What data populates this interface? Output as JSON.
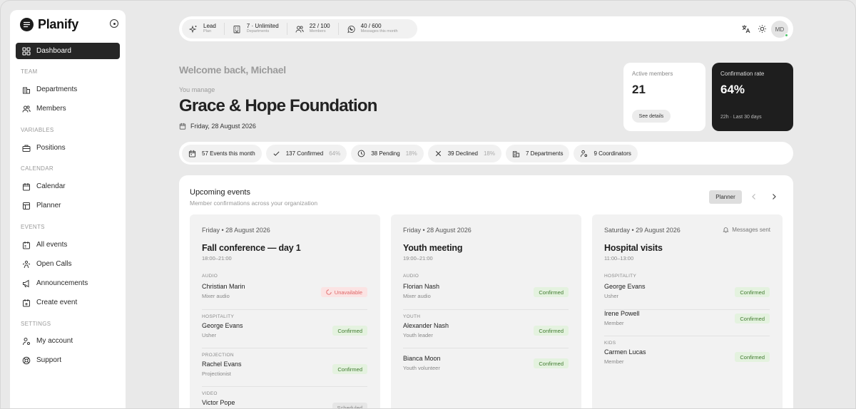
{
  "brand": {
    "name": "Planify"
  },
  "sidebar": {
    "items": [
      {
        "label": "Dashboard",
        "icon": "dashboard-icon",
        "active": true
      },
      {
        "section": "TEAM"
      },
      {
        "label": "Departments",
        "icon": "building-icon"
      },
      {
        "label": "Members",
        "icon": "users-icon"
      },
      {
        "section": "VARIABLES"
      },
      {
        "label": "Positions",
        "icon": "briefcase-icon"
      },
      {
        "section": "CALENDAR"
      },
      {
        "label": "Calendar",
        "icon": "calendar-icon"
      },
      {
        "label": "Planner",
        "icon": "grid-icon"
      },
      {
        "section": "EVENTS"
      },
      {
        "label": "All events",
        "icon": "calendar-list-icon"
      },
      {
        "label": "Open Calls",
        "icon": "people-call-icon"
      },
      {
        "label": "Announcements",
        "icon": "megaphone-icon"
      },
      {
        "label": "Create event",
        "icon": "calendar-plus-icon"
      },
      {
        "section": "SETTINGS"
      },
      {
        "label": "My account",
        "icon": "user-settings-icon"
      },
      {
        "label": "Support",
        "icon": "lifebuoy-icon"
      }
    ]
  },
  "topbar": {
    "stats": [
      {
        "main": "Lead",
        "sub": "Plan",
        "icon": "sparkle-icon"
      },
      {
        "main": "7 · Unlimited",
        "sub": "Departments",
        "icon": "building-icon"
      },
      {
        "main": "22 / 100",
        "sub": "Members",
        "icon": "users-icon"
      },
      {
        "main": "40 / 600",
        "sub": "Messages this month",
        "icon": "whatsapp-icon"
      }
    ],
    "avatar_initials": "MD"
  },
  "welcome": {
    "greeting": "Welcome back, Michael",
    "you_manage": "You manage",
    "org_name": "Grace & Hope Foundation",
    "date": "Friday, 28 August 2026"
  },
  "cards": {
    "active_members": {
      "label": "Active members",
      "value": "21",
      "button": "See details"
    },
    "confirmation_rate": {
      "label": "Confirmation rate",
      "value": "64%",
      "foot": "22h · Last 30 days"
    }
  },
  "summary": [
    {
      "text": "57 Events this month",
      "pct": "",
      "icon": "calendar-icon"
    },
    {
      "text": "137 Confirmed",
      "pct": "64%",
      "icon": "check-icon"
    },
    {
      "text": "38 Pending",
      "pct": "18%",
      "icon": "clock-icon"
    },
    {
      "text": "39 Declined",
      "pct": "18%",
      "icon": "x-icon"
    },
    {
      "text": "7 Departments",
      "pct": "",
      "icon": "building-icon"
    },
    {
      "text": "9 Coordinators",
      "pct": "",
      "icon": "user-settings-icon"
    }
  ],
  "events": {
    "title": "Upcoming events",
    "subtitle": "Member confirmations across your organization",
    "planner_button": "Planner",
    "cards": [
      {
        "date": "Friday • 28 August 2026",
        "status": "",
        "title": "Fall conference — day 1",
        "time": "18:00–21:00",
        "rows": [
          {
            "dept": "AUDIO",
            "name": "Christian Marin",
            "role": "Mixer audio",
            "badge": "Unavailable",
            "badge_type": "unavailable"
          },
          {
            "dept": "HOSPITALITY",
            "name": "George Evans",
            "role": "Usher",
            "badge": "Confirmed",
            "badge_type": "confirmed"
          },
          {
            "dept": "PROJECTION",
            "name": "Rachel Evans",
            "role": "Projectionist",
            "badge": "Confirmed",
            "badge_type": "confirmed"
          },
          {
            "dept": "VIDEO",
            "name": "Victor Pope",
            "role": "",
            "badge": "Scheduled",
            "badge_type": "scheduled"
          }
        ]
      },
      {
        "date": "Friday • 28 August 2026",
        "status": "",
        "title": "Youth meeting",
        "time": "19:00–21:00",
        "rows": [
          {
            "dept": "AUDIO",
            "name": "Florian Nash",
            "role": "Mixer audio",
            "badge": "Confirmed",
            "badge_type": "confirmed"
          },
          {
            "dept": "YOUTH",
            "name": "Alexander Nash",
            "role": "Youth leader",
            "badge": "Confirmed",
            "badge_type": "confirmed"
          },
          {
            "dept": "",
            "name": "Bianca Moon",
            "role": "Youth volunteer",
            "badge": "Confirmed",
            "badge_type": "confirmed"
          }
        ]
      },
      {
        "date": "Saturday • 29 August 2026",
        "status": "Messages sent",
        "title": "Hospital visits",
        "time": "11:00–13:00",
        "rows": [
          {
            "dept": "HOSPITALITY",
            "name": "George Evans",
            "role": "Usher",
            "badge": "Confirmed",
            "badge_type": "confirmed"
          },
          {
            "dept": "",
            "name": "Irene Powell",
            "role": "Member",
            "badge": "Confirmed",
            "badge_type": "confirmed"
          },
          {
            "dept": "KIDS",
            "name": "Carmen Lucas",
            "role": "Member",
            "badge": "Confirmed",
            "badge_type": "confirmed"
          }
        ]
      }
    ]
  }
}
